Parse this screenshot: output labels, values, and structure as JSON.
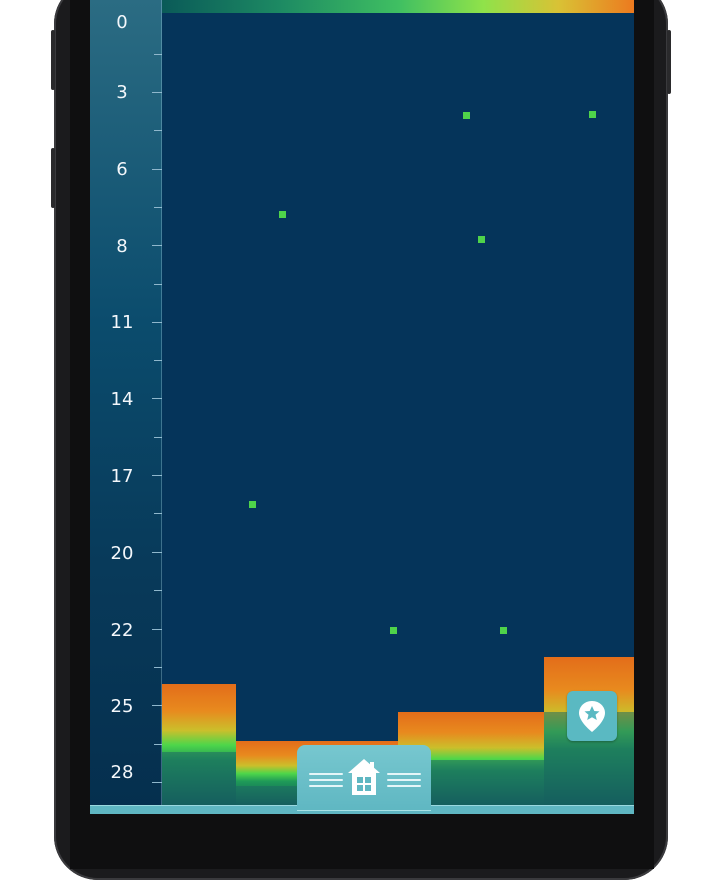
{
  "depth_scale": {
    "labels": [
      "0",
      "3",
      "6",
      "8",
      "11",
      "14",
      "17",
      "20",
      "22",
      "25",
      "28"
    ]
  },
  "colors": {
    "water": "#05345a",
    "fish_target": "#4fd34a",
    "colorbar": [
      "#0a5a58",
      "#3fbf62",
      "#8fe24a",
      "#d9c235",
      "#ec7a1f"
    ]
  },
  "fish_targets_count": 8,
  "icons": {
    "home": "home-icon",
    "waypoint": "map-pin-star-icon"
  }
}
